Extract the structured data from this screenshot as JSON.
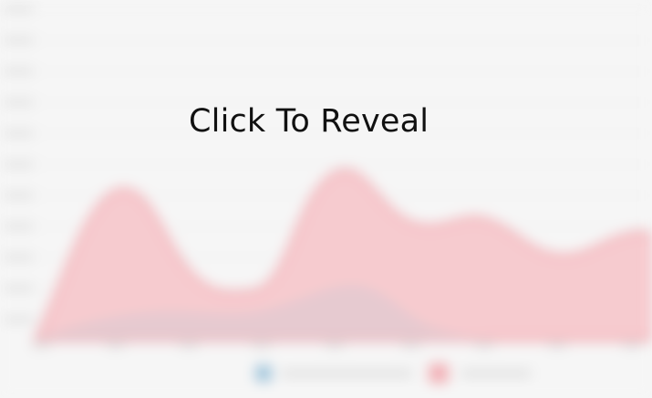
{
  "reveal": {
    "label": "Click To Reveal"
  },
  "colors": {
    "background": "#f6f6f6",
    "accent_red": "#f7c9cd",
    "accent_red_stroke": "#f1aeb5",
    "accent_blue": "#9dc3db",
    "grid": "#e8e8e8",
    "label": "#111111"
  }
}
